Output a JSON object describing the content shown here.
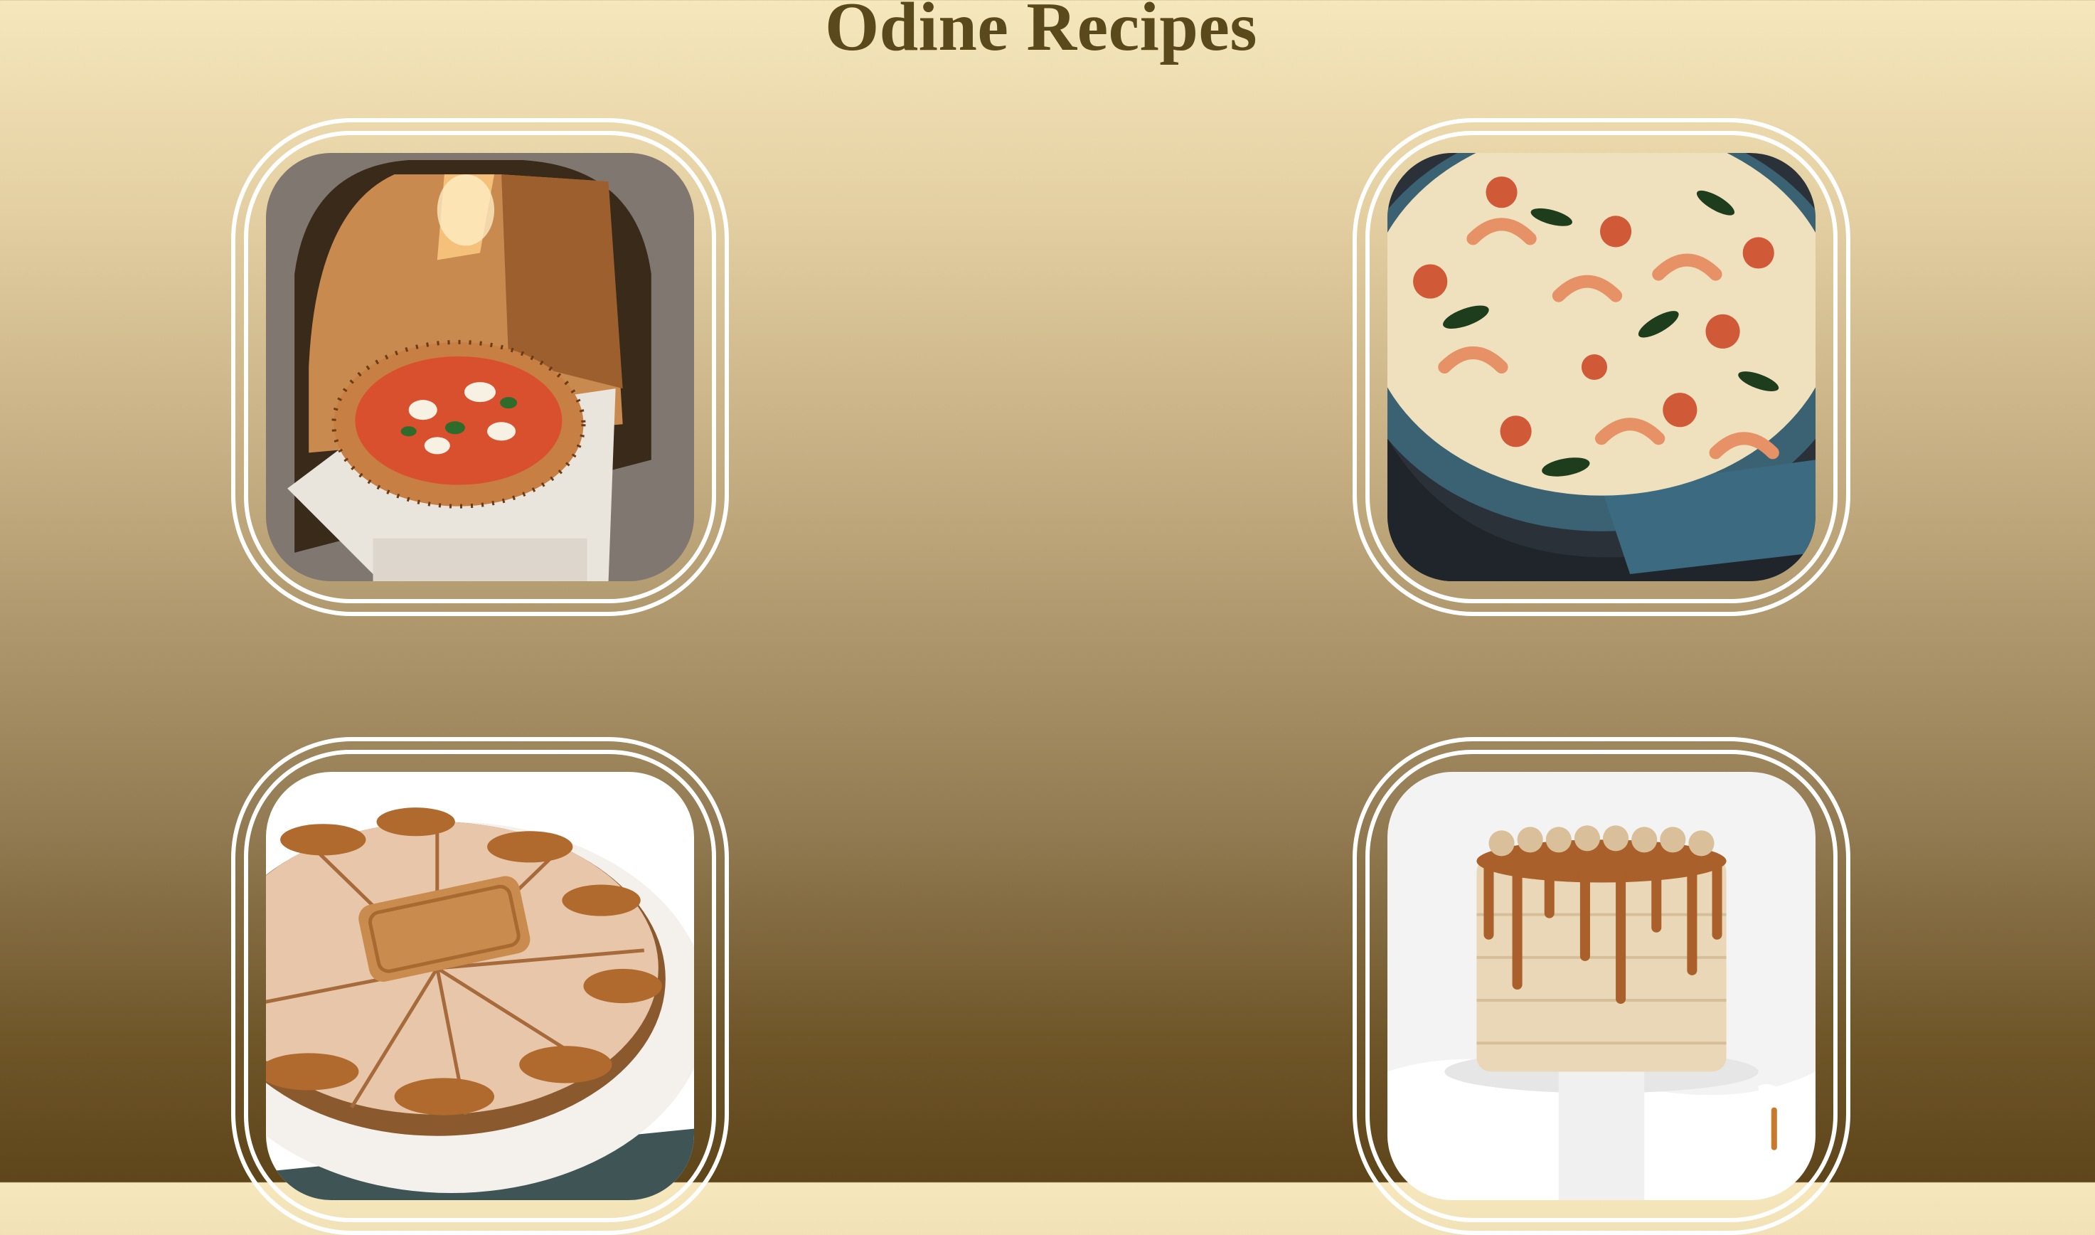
{
  "page": {
    "title": "Odine Recipes"
  },
  "recipes": [
    {
      "image_icon": "pizza-image"
    },
    {
      "image_icon": "shrimp-skillet-image"
    },
    {
      "image_icon": "biscoff-cheesecake-image"
    },
    {
      "image_icon": "caramel-drip-cake-image"
    }
  ],
  "colors": {
    "title": "#5a4a1b",
    "frame": "#ffffff",
    "background_top": "#f6e7bd",
    "background_bottom": "#5e451a"
  }
}
